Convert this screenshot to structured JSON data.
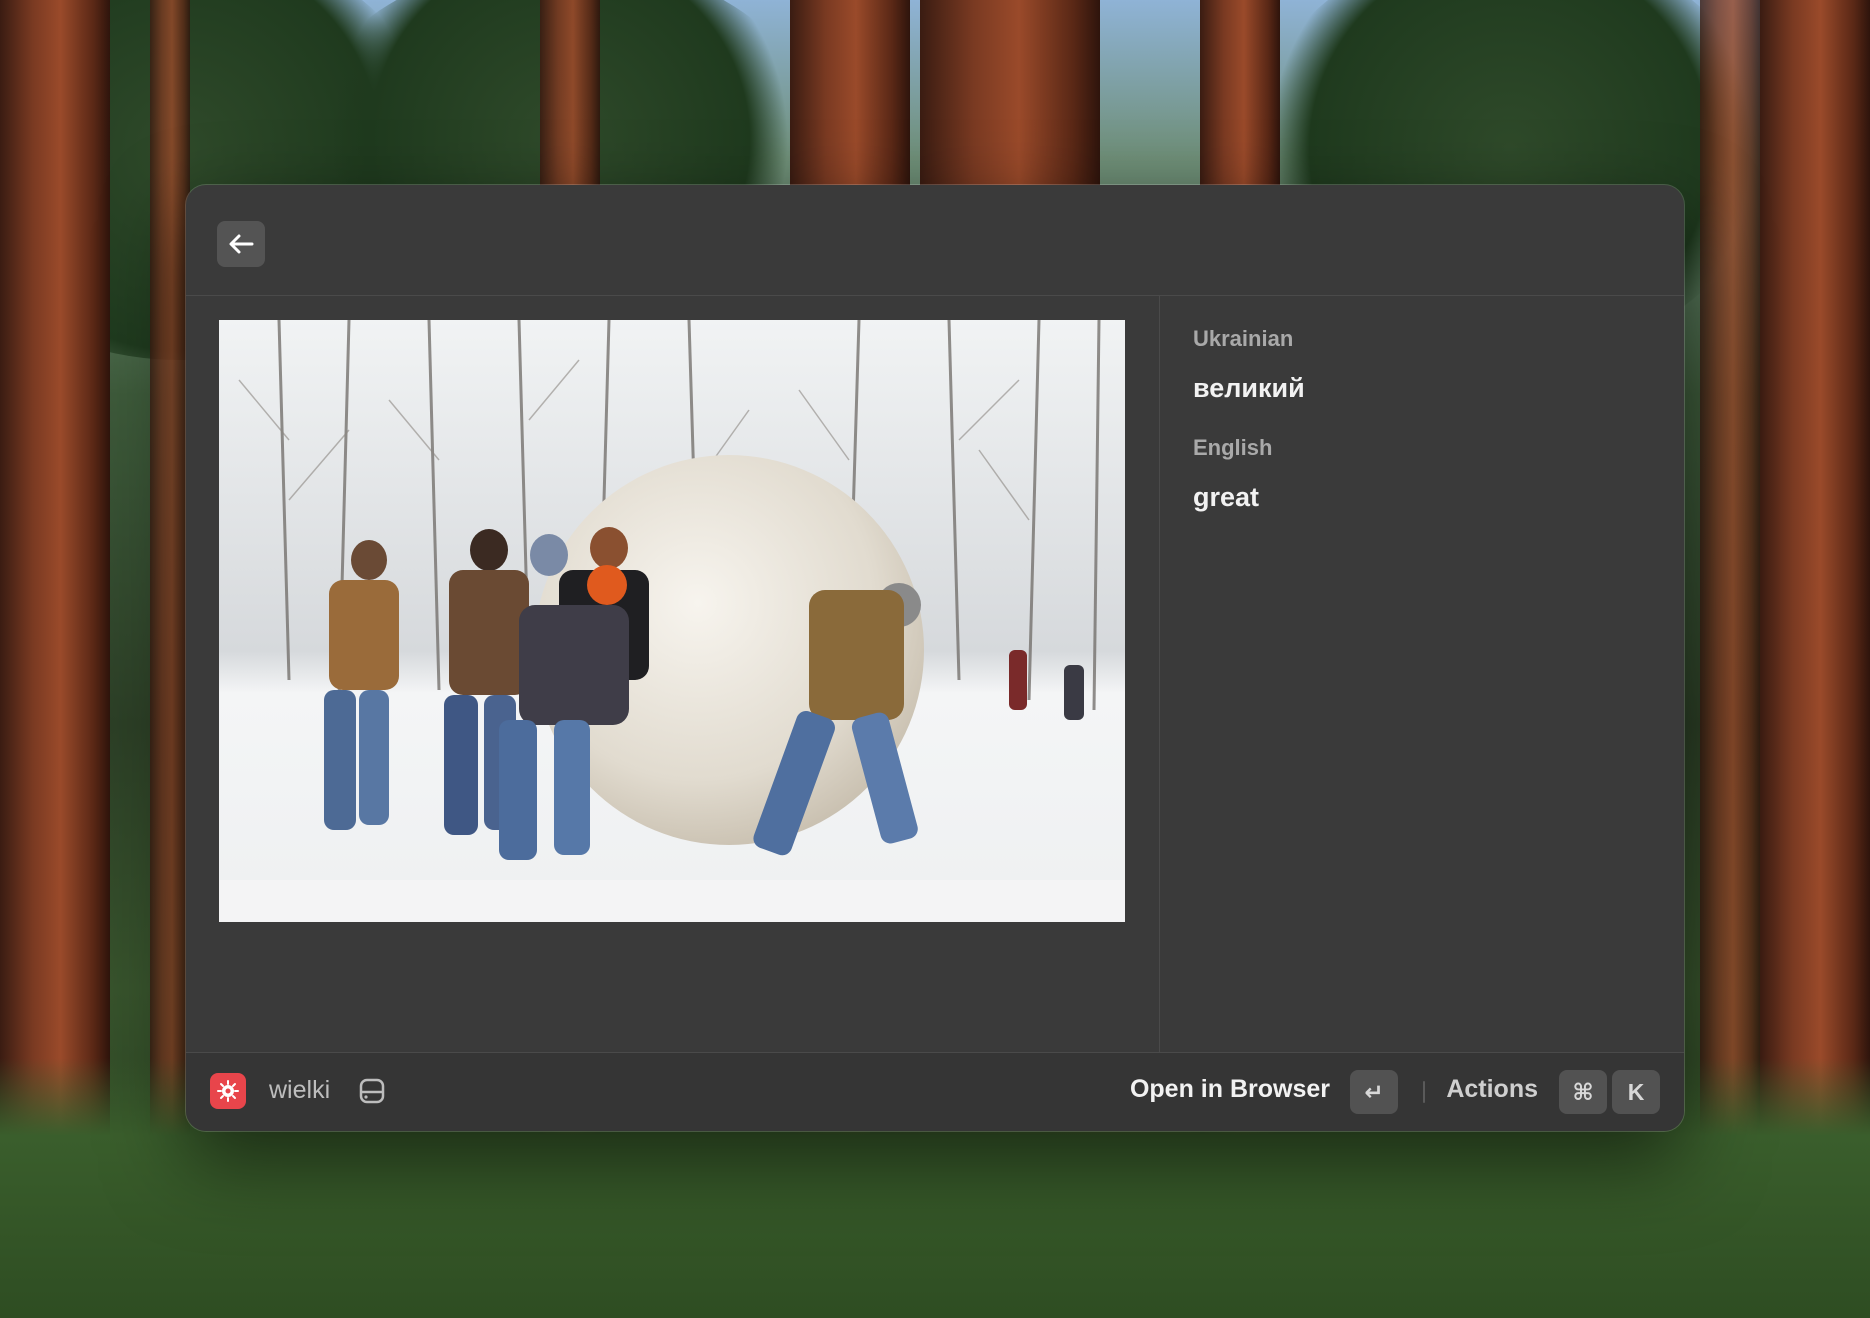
{
  "topbar": {
    "back_icon": "arrow-left-icon"
  },
  "detail": {
    "image_alt": "Group of people pushing a giant snowball in a snowy forest",
    "fields": [
      {
        "label": "Ukrainian",
        "value": "великий"
      },
      {
        "label": "English",
        "value": "great"
      }
    ]
  },
  "footer": {
    "app_icon": "translate-app-icon",
    "query": "wielki",
    "query_icon": "drive-icon",
    "primary_action": "Open in Browser",
    "primary_shortcut": "↵",
    "secondary_action": "Actions",
    "secondary_shortcut": [
      "⌘",
      "K"
    ]
  },
  "colors": {
    "window_bg": "#3a3a3a",
    "accent_red": "#e8454b"
  }
}
